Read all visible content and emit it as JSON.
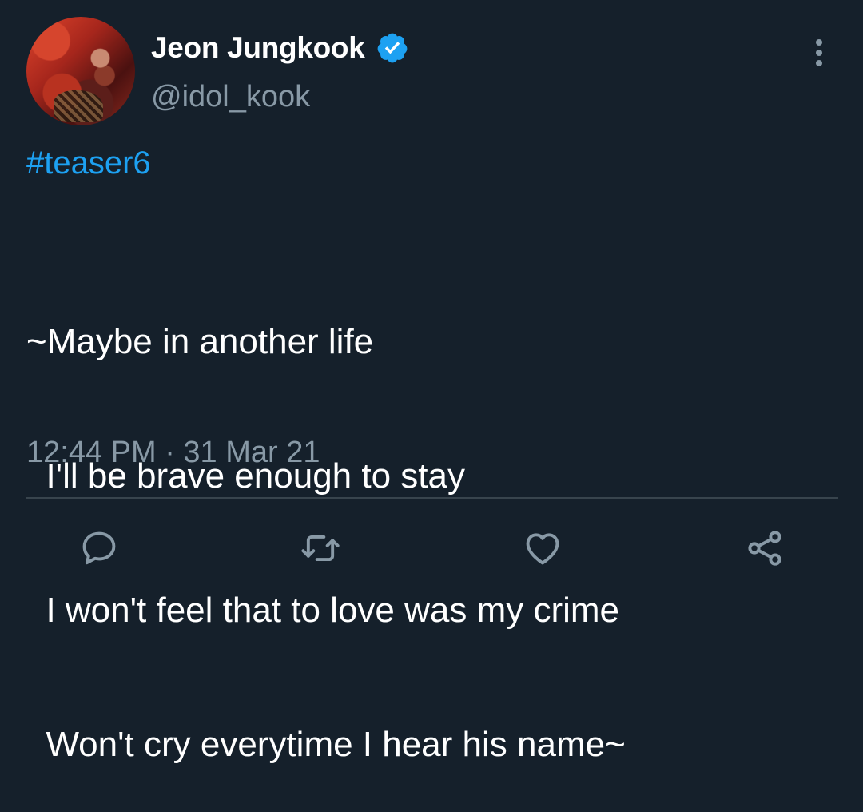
{
  "author": {
    "display_name": "Jeon Jungkook",
    "handle": "@idol_kook",
    "verified": true
  },
  "tweet": {
    "hashtag": "#teaser6",
    "lines": [
      "~Maybe in another life",
      "  I'll be brave enough to stay",
      "  I won't feel that to love was my crime",
      "  Won't cry everytime I hear his name~"
    ],
    "timestamp": "12:44 PM · 31 Mar 21"
  },
  "icons": {
    "verified": "verified-badge-icon",
    "more": "more-options-icon",
    "reply": "reply-icon",
    "retweet": "retweet-icon",
    "like": "like-icon",
    "share": "share-icon"
  },
  "colors": {
    "background": "#15202b",
    "accent": "#1da1f2",
    "secondary_text": "#8899a6",
    "divider": "#38444d"
  }
}
